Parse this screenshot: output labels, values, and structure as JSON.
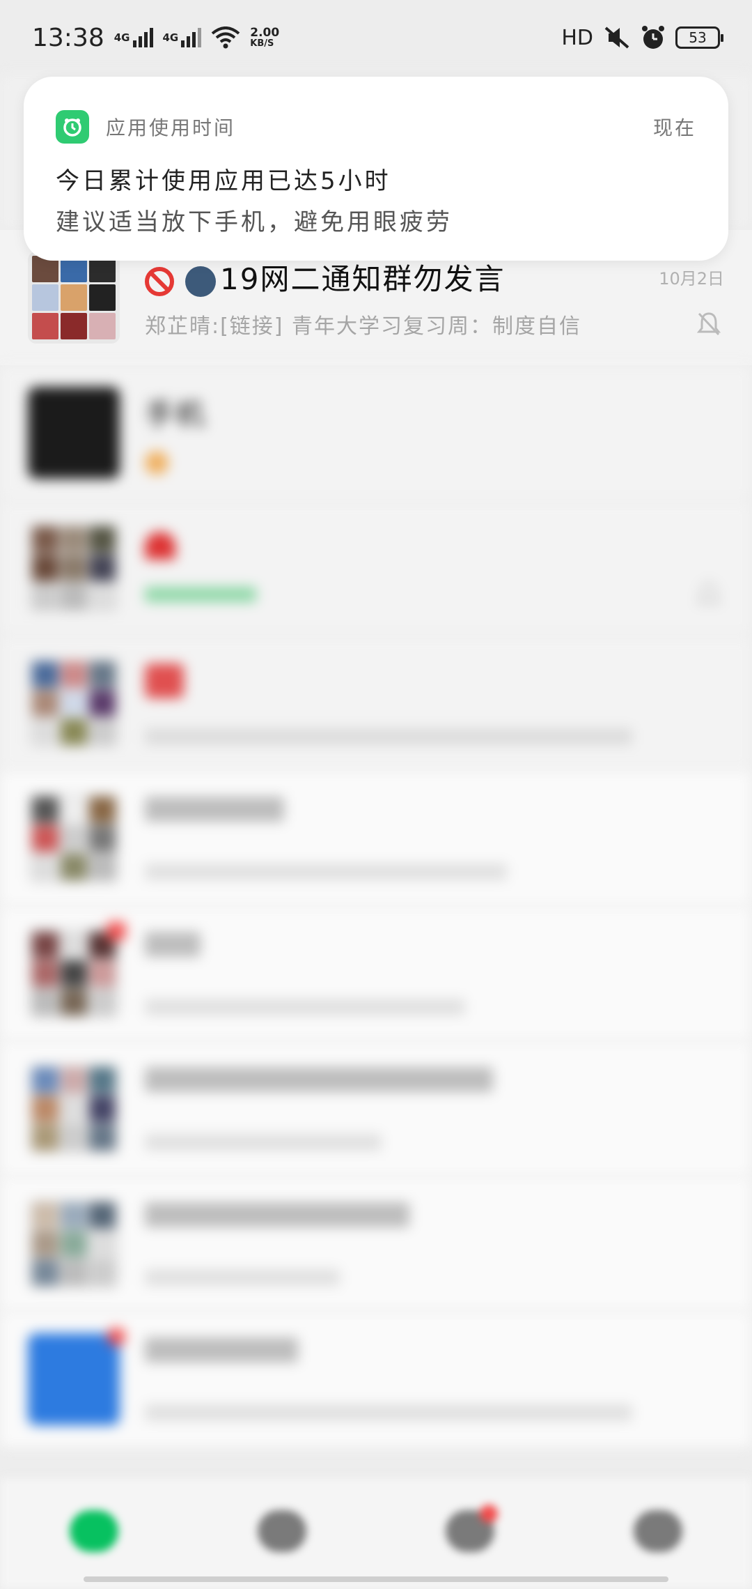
{
  "status_bar": {
    "time": "13:38",
    "signal1": "4G",
    "signal2": "4G",
    "net_speed_value": "2.00",
    "net_speed_unit": "KB/S",
    "hd_label": "HD",
    "battery": "53"
  },
  "notification": {
    "app_name": "应用使用时间",
    "time": "现在",
    "title": "今日累计使用应用已达5小时",
    "text": "建议适当放下手机，避免用眼疲劳",
    "accent": "#2fcb72"
  },
  "chats": [
    {
      "title": "19网二通知群勿发言",
      "subtitle": "郑芷晴:[链接] 青年大学习复习周：制度自信",
      "time": "10月2日"
    },
    {
      "title": "手机",
      "subtitle": "",
      "time": ""
    },
    {
      "title": "",
      "subtitle": "",
      "time": ""
    },
    {
      "title": "",
      "subtitle": "",
      "time": ""
    },
    {
      "title": "",
      "subtitle": "",
      "time": ""
    },
    {
      "title": "",
      "subtitle": "",
      "time": ""
    },
    {
      "title": "",
      "subtitle": "",
      "time": ""
    },
    {
      "title": "",
      "subtitle": "",
      "time": ""
    },
    {
      "title": "",
      "subtitle": "",
      "time": ""
    }
  ],
  "bottom_nav": [
    {
      "label": ""
    },
    {
      "label": ""
    },
    {
      "label": ""
    },
    {
      "label": ""
    }
  ]
}
